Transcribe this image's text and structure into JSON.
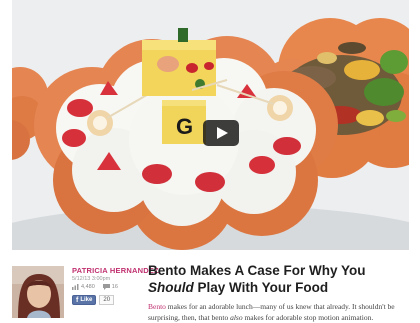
{
  "article": {
    "headline_part1": "Bento Makes A Case For Why You ",
    "headline_em": "Should",
    "headline_part2": " Play With Your Food",
    "excerpt_link": "Bento",
    "excerpt_part1": " makes for an adorable lunch—many of us knew that already. It shouldn't be surprising, then, that bento ",
    "excerpt_em": "also",
    "excerpt_part2": " makes for adorable stop motion animation."
  },
  "author": {
    "name": "PATRICIA HERNANDEZ",
    "date": "5/12/13 3:00pm",
    "views": "4,480",
    "comments": "16"
  },
  "social": {
    "like_label": "Like",
    "like_count": "20"
  },
  "video": {
    "letter_block": "G"
  },
  "colors": {
    "accent": "#c0306f",
    "facebook": "#5b74a8",
    "bento_box": "#e07a45"
  }
}
